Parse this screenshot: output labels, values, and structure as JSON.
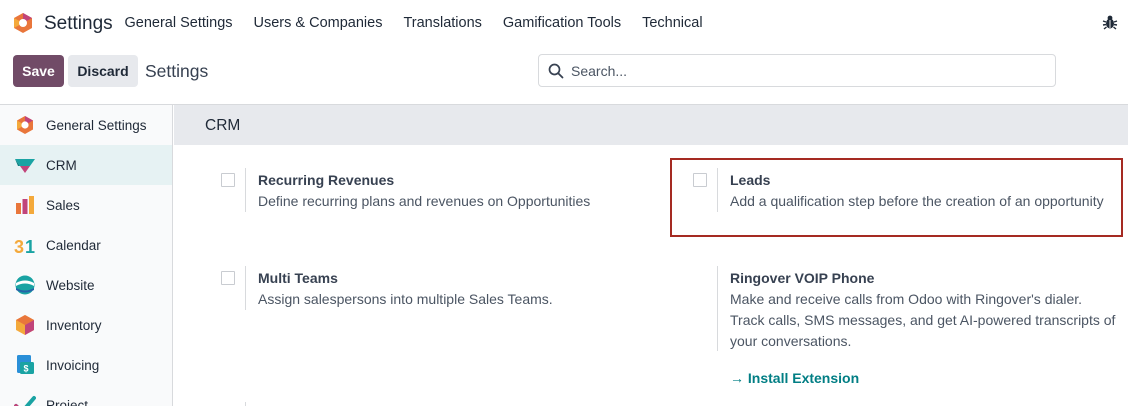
{
  "navbar": {
    "app_name": "Settings",
    "menu": [
      "General Settings",
      "Users & Companies",
      "Translations",
      "Gamification Tools",
      "Technical"
    ]
  },
  "control_panel": {
    "save_label": "Save",
    "discard_label": "Discard",
    "breadcrumb": "Settings",
    "search_placeholder": "Search..."
  },
  "sidebar": {
    "items": [
      {
        "label": "General Settings",
        "icon": "odoo-logo-icon"
      },
      {
        "label": "CRM",
        "icon": "crm-icon",
        "active": true
      },
      {
        "label": "Sales",
        "icon": "sales-icon"
      },
      {
        "label": "Calendar",
        "icon": "calendar-icon"
      },
      {
        "label": "Website",
        "icon": "website-icon"
      },
      {
        "label": "Inventory",
        "icon": "inventory-icon"
      },
      {
        "label": "Invoicing",
        "icon": "invoicing-icon"
      },
      {
        "label": "Project",
        "icon": "project-icon"
      }
    ]
  },
  "section": {
    "title": "CRM",
    "settings": [
      {
        "title": "Recurring Revenues",
        "desc": "Define recurring plans and revenues on Opportunities",
        "checked": false
      },
      {
        "title": "Leads",
        "desc": "Add a qualification step before the creation of an opportunity",
        "checked": false
      },
      {
        "title": "Multi Teams",
        "desc": "Assign salespersons into multiple Sales Teams.",
        "checked": false
      },
      {
        "title": "Ringover VOIP Phone",
        "desc": "Make and receive calls from Odoo with Ringover's dialer. Track calls, SMS messages, and get AI-powered transcripts of your conversations.",
        "link": "→ Install Extension"
      }
    ]
  },
  "colors": {
    "brand": "#714b67",
    "link": "#017e84",
    "highlight": "#a52a22"
  }
}
